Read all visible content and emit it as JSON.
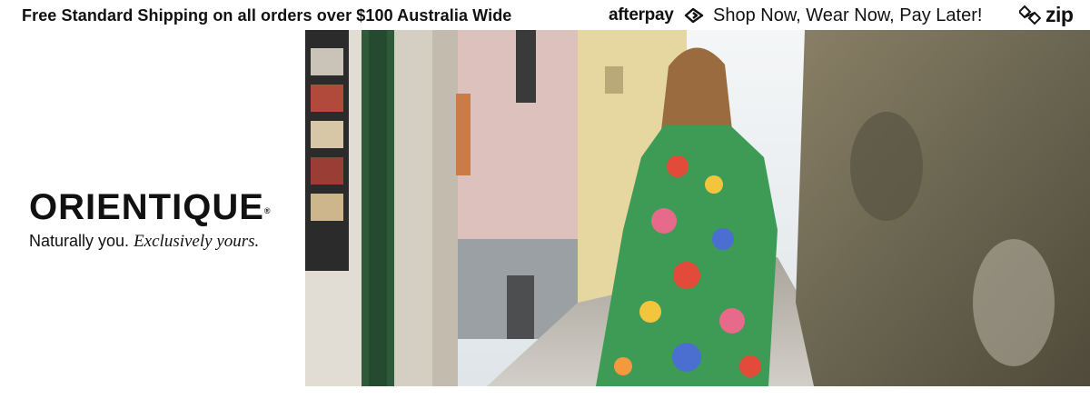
{
  "topbar": {
    "shipping_text": "Free Standard Shipping on all orders over $100 Australia Wide",
    "afterpay_logo": "afterpay",
    "afterpay_tagline": "Shop Now, Wear Now, Pay Later!",
    "zip_logo": "zip"
  },
  "brand": {
    "name": "ORIENTIQUE",
    "registered_mark": "®",
    "slogan_plain": "Naturally you.",
    "slogan_emphasis": "Exclusively yours."
  },
  "hero": {
    "icon": "fashion-photo-image",
    "colors": {
      "wall_left": "#e2ddd4",
      "door_green": "#2f5a3a",
      "mossy_wall": "#6d6452",
      "cobble": "#bdbab3"
    }
  }
}
